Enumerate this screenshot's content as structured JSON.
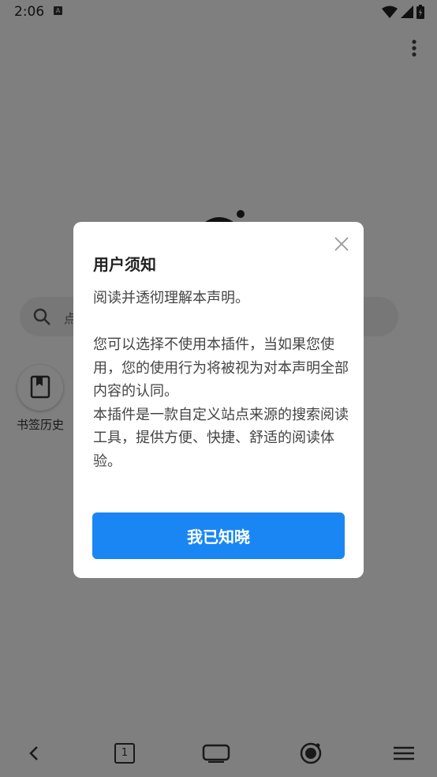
{
  "status_bar": {
    "time": "2:06",
    "notification_letter": "A"
  },
  "search": {
    "placeholder": "点"
  },
  "shortcuts": [
    {
      "label": "书签历史",
      "icon": "bookmark-icon"
    }
  ],
  "bottom_nav": {
    "tab_count": "1"
  },
  "dialog": {
    "title": "用户须知",
    "paragraphs": [
      "阅读并透彻理解本声明。",
      "",
      "您可以选择不使用本插件，当如果您使用，您的使用行为将被视为对本声明全部内容的认同。",
      "本插件是一款自定义站点来源的搜索阅读工具，提供方便、快捷、舒适的阅读体验。"
    ],
    "confirm_label": "我已知晓"
  },
  "colors": {
    "accent": "#1a86f4",
    "overlay": "rgba(0,0,0,0.5)"
  }
}
